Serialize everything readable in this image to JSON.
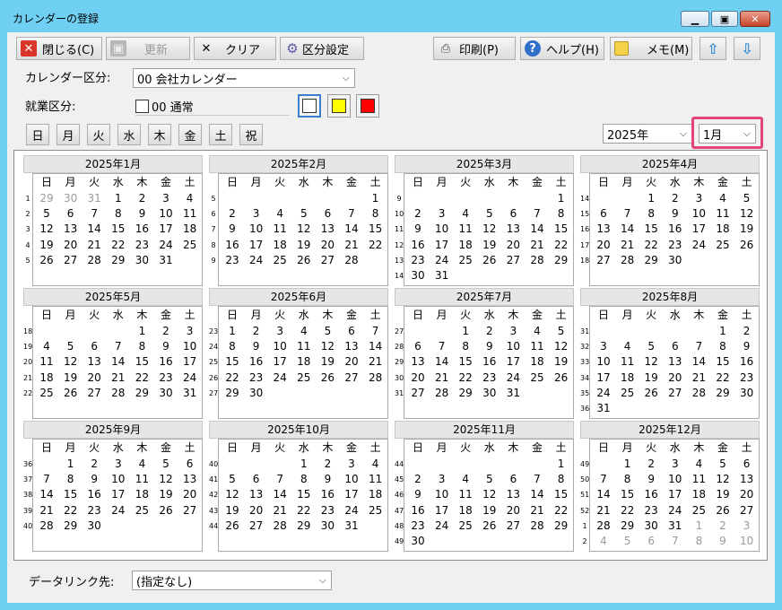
{
  "window": {
    "title": "カレンダーの登録"
  },
  "toolbar": {
    "close_label": "閉じる(C)",
    "update_label": "更新",
    "clear_label": "クリア",
    "category_label": "区分設定",
    "print_label": "印刷(P)",
    "help_label": "ヘルプ(H)",
    "memo_label": "メモ(M)"
  },
  "form": {
    "calendar_label": "カレンダー区分:",
    "calendar_value": "00 会社カレンダー",
    "work_label": "就業区分:",
    "work_value": "00 通常",
    "colors": [
      "#ffffff",
      "#ffff00",
      "#ff0000"
    ],
    "year_value": "2025年",
    "month_value": "1月",
    "highlight_color": "#e0457b"
  },
  "weekday_buttons": [
    "日",
    "月",
    "火",
    "水",
    "木",
    "金",
    "土",
    "祝"
  ],
  "weekday_headers": [
    "日",
    "月",
    "火",
    "水",
    "木",
    "金",
    "土"
  ],
  "months": [
    {
      "title": "2025年1月",
      "weeks": [
        {
          "no": "1",
          "days": [
            "29",
            "30",
            "31",
            "1",
            "2",
            "3",
            "4"
          ],
          "other": [
            true,
            true,
            true,
            false,
            false,
            false,
            false
          ]
        },
        {
          "no": "2",
          "days": [
            "5",
            "6",
            "7",
            "8",
            "9",
            "10",
            "11"
          ]
        },
        {
          "no": "3",
          "days": [
            "12",
            "13",
            "14",
            "15",
            "16",
            "17",
            "18"
          ]
        },
        {
          "no": "4",
          "days": [
            "19",
            "20",
            "21",
            "22",
            "23",
            "24",
            "25"
          ]
        },
        {
          "no": "5",
          "days": [
            "26",
            "27",
            "28",
            "29",
            "30",
            "31",
            ""
          ]
        }
      ]
    },
    {
      "title": "2025年2月",
      "weeks": [
        {
          "no": "5",
          "days": [
            "",
            "",
            "",
            "",
            "",
            "",
            "1"
          ]
        },
        {
          "no": "6",
          "days": [
            "2",
            "3",
            "4",
            "5",
            "6",
            "7",
            "8"
          ]
        },
        {
          "no": "7",
          "days": [
            "9",
            "10",
            "11",
            "12",
            "13",
            "14",
            "15"
          ]
        },
        {
          "no": "8",
          "days": [
            "16",
            "17",
            "18",
            "19",
            "20",
            "21",
            "22"
          ]
        },
        {
          "no": "9",
          "days": [
            "23",
            "24",
            "25",
            "26",
            "27",
            "28",
            ""
          ]
        }
      ]
    },
    {
      "title": "2025年3月",
      "weeks": [
        {
          "no": "9",
          "days": [
            "",
            "",
            "",
            "",
            "",
            "",
            "1"
          ]
        },
        {
          "no": "10",
          "days": [
            "2",
            "3",
            "4",
            "5",
            "6",
            "7",
            "8"
          ]
        },
        {
          "no": "11",
          "days": [
            "9",
            "10",
            "11",
            "12",
            "13",
            "14",
            "15"
          ]
        },
        {
          "no": "12",
          "days": [
            "16",
            "17",
            "18",
            "19",
            "20",
            "21",
            "22"
          ]
        },
        {
          "no": "13",
          "days": [
            "23",
            "24",
            "25",
            "26",
            "27",
            "28",
            "29"
          ]
        },
        {
          "no": "14",
          "days": [
            "30",
            "31",
            "",
            "",
            "",
            "",
            ""
          ]
        }
      ]
    },
    {
      "title": "2025年4月",
      "weeks": [
        {
          "no": "14",
          "days": [
            "",
            "",
            "1",
            "2",
            "3",
            "4",
            "5"
          ]
        },
        {
          "no": "15",
          "days": [
            "6",
            "7",
            "8",
            "9",
            "10",
            "11",
            "12"
          ]
        },
        {
          "no": "16",
          "days": [
            "13",
            "14",
            "15",
            "16",
            "17",
            "18",
            "19"
          ]
        },
        {
          "no": "17",
          "days": [
            "20",
            "21",
            "22",
            "23",
            "24",
            "25",
            "26"
          ]
        },
        {
          "no": "18",
          "days": [
            "27",
            "28",
            "29",
            "30",
            "",
            "",
            ""
          ]
        }
      ]
    },
    {
      "title": "2025年5月",
      "weeks": [
        {
          "no": "18",
          "days": [
            "",
            "",
            "",
            "",
            "1",
            "2",
            "3"
          ]
        },
        {
          "no": "19",
          "days": [
            "4",
            "5",
            "6",
            "7",
            "8",
            "9",
            "10"
          ]
        },
        {
          "no": "20",
          "days": [
            "11",
            "12",
            "13",
            "14",
            "15",
            "16",
            "17"
          ]
        },
        {
          "no": "21",
          "days": [
            "18",
            "19",
            "20",
            "21",
            "22",
            "23",
            "24"
          ]
        },
        {
          "no": "22",
          "days": [
            "25",
            "26",
            "27",
            "28",
            "29",
            "30",
            "31"
          ]
        }
      ]
    },
    {
      "title": "2025年6月",
      "weeks": [
        {
          "no": "23",
          "days": [
            "1",
            "2",
            "3",
            "4",
            "5",
            "6",
            "7"
          ]
        },
        {
          "no": "24",
          "days": [
            "8",
            "9",
            "10",
            "11",
            "12",
            "13",
            "14"
          ]
        },
        {
          "no": "25",
          "days": [
            "15",
            "16",
            "17",
            "18",
            "19",
            "20",
            "21"
          ]
        },
        {
          "no": "26",
          "days": [
            "22",
            "23",
            "24",
            "25",
            "26",
            "27",
            "28"
          ]
        },
        {
          "no": "27",
          "days": [
            "29",
            "30",
            "",
            "",
            "",
            "",
            ""
          ]
        }
      ]
    },
    {
      "title": "2025年7月",
      "weeks": [
        {
          "no": "27",
          "days": [
            "",
            "",
            "1",
            "2",
            "3",
            "4",
            "5"
          ]
        },
        {
          "no": "28",
          "days": [
            "6",
            "7",
            "8",
            "9",
            "10",
            "11",
            "12"
          ]
        },
        {
          "no": "29",
          "days": [
            "13",
            "14",
            "15",
            "16",
            "17",
            "18",
            "19"
          ]
        },
        {
          "no": "30",
          "days": [
            "20",
            "21",
            "22",
            "23",
            "24",
            "25",
            "26"
          ]
        },
        {
          "no": "31",
          "days": [
            "27",
            "28",
            "29",
            "30",
            "31",
            "",
            ""
          ]
        }
      ]
    },
    {
      "title": "2025年8月",
      "weeks": [
        {
          "no": "31",
          "days": [
            "",
            "",
            "",
            "",
            "",
            "1",
            "2"
          ]
        },
        {
          "no": "32",
          "days": [
            "3",
            "4",
            "5",
            "6",
            "7",
            "8",
            "9"
          ]
        },
        {
          "no": "33",
          "days": [
            "10",
            "11",
            "12",
            "13",
            "14",
            "15",
            "16"
          ]
        },
        {
          "no": "34",
          "days": [
            "17",
            "18",
            "19",
            "20",
            "21",
            "22",
            "23"
          ]
        },
        {
          "no": "35",
          "days": [
            "24",
            "25",
            "26",
            "27",
            "28",
            "29",
            "30"
          ]
        },
        {
          "no": "36",
          "days": [
            "31",
            "",
            "",
            "",
            "",
            "",
            ""
          ]
        }
      ]
    },
    {
      "title": "2025年9月",
      "weeks": [
        {
          "no": "36",
          "days": [
            "",
            "1",
            "2",
            "3",
            "4",
            "5",
            "6"
          ]
        },
        {
          "no": "37",
          "days": [
            "7",
            "8",
            "9",
            "10",
            "11",
            "12",
            "13"
          ]
        },
        {
          "no": "38",
          "days": [
            "14",
            "15",
            "16",
            "17",
            "18",
            "19",
            "20"
          ]
        },
        {
          "no": "39",
          "days": [
            "21",
            "22",
            "23",
            "24",
            "25",
            "26",
            "27"
          ]
        },
        {
          "no": "40",
          "days": [
            "28",
            "29",
            "30",
            "",
            "",
            "",
            ""
          ]
        }
      ]
    },
    {
      "title": "2025年10月",
      "weeks": [
        {
          "no": "40",
          "days": [
            "",
            "",
            "",
            "1",
            "2",
            "3",
            "4"
          ]
        },
        {
          "no": "41",
          "days": [
            "5",
            "6",
            "7",
            "8",
            "9",
            "10",
            "11"
          ]
        },
        {
          "no": "42",
          "days": [
            "12",
            "13",
            "14",
            "15",
            "16",
            "17",
            "18"
          ]
        },
        {
          "no": "43",
          "days": [
            "19",
            "20",
            "21",
            "22",
            "23",
            "24",
            "25"
          ]
        },
        {
          "no": "44",
          "days": [
            "26",
            "27",
            "28",
            "29",
            "30",
            "31",
            ""
          ]
        }
      ]
    },
    {
      "title": "2025年11月",
      "weeks": [
        {
          "no": "44",
          "days": [
            "",
            "",
            "",
            "",
            "",
            "",
            "1"
          ]
        },
        {
          "no": "45",
          "days": [
            "2",
            "3",
            "4",
            "5",
            "6",
            "7",
            "8"
          ]
        },
        {
          "no": "46",
          "days": [
            "9",
            "10",
            "11",
            "12",
            "13",
            "14",
            "15"
          ]
        },
        {
          "no": "47",
          "days": [
            "16",
            "17",
            "18",
            "19",
            "20",
            "21",
            "22"
          ]
        },
        {
          "no": "48",
          "days": [
            "23",
            "24",
            "25",
            "26",
            "27",
            "28",
            "29"
          ]
        },
        {
          "no": "49",
          "days": [
            "30",
            "",
            "",
            "",
            "",
            "",
            ""
          ]
        }
      ]
    },
    {
      "title": "2025年12月",
      "weeks": [
        {
          "no": "49",
          "days": [
            "",
            "1",
            "2",
            "3",
            "4",
            "5",
            "6"
          ]
        },
        {
          "no": "50",
          "days": [
            "7",
            "8",
            "9",
            "10",
            "11",
            "12",
            "13"
          ]
        },
        {
          "no": "51",
          "days": [
            "14",
            "15",
            "16",
            "17",
            "18",
            "19",
            "20"
          ]
        },
        {
          "no": "52",
          "days": [
            "21",
            "22",
            "23",
            "24",
            "25",
            "26",
            "27"
          ]
        },
        {
          "no": "1",
          "days": [
            "28",
            "29",
            "30",
            "31",
            "1",
            "2",
            "3"
          ],
          "other": [
            false,
            false,
            false,
            false,
            true,
            true,
            true
          ]
        },
        {
          "no": "2",
          "days": [
            "4",
            "5",
            "6",
            "7",
            "8",
            "9",
            "10"
          ],
          "other": [
            true,
            true,
            true,
            true,
            true,
            true,
            true
          ]
        }
      ]
    }
  ],
  "footer": {
    "datalink_label": "データリンク先:",
    "datalink_value": "(指定なし)"
  }
}
